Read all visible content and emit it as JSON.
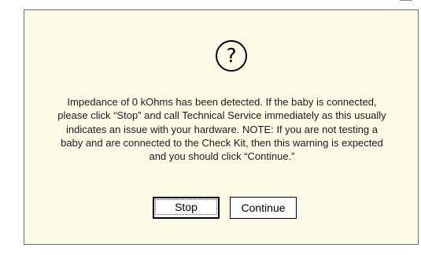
{
  "dialog": {
    "icon": "question-icon",
    "icon_glyph": "?",
    "message": "Impedance of 0 kOhms has been detected.  If the baby is connected, please click “Stop” and call Technical Service immediately as this usually indicates an issue with your hardware.  NOTE:  If you are not testing a baby and are connected to the Check Kit, then this warning is expected and you should click “Continue.”",
    "stop_label": "Stop",
    "continue_label": "Continue",
    "background_color": "#fdfbe6",
    "border_color": "#6d6d6d"
  }
}
